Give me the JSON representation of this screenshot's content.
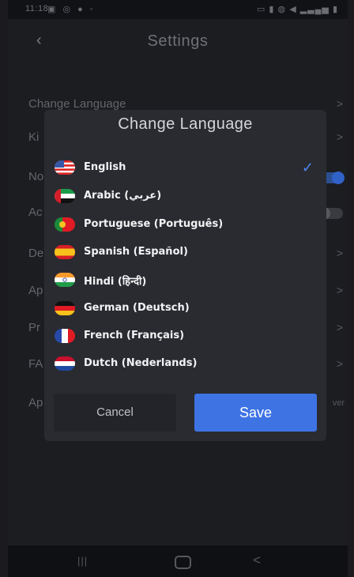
{
  "status_bar": {
    "time": "11:18",
    "left_icons": "▣ ◎ ● ◦",
    "right_icons": "▭ ▮ ◍ ◀ ▂▃▄▅ ▮"
  },
  "header": {
    "title": "Settings"
  },
  "settings": {
    "items": [
      {
        "label": "Change Language",
        "control": "chevron"
      },
      {
        "label": "Ki",
        "control": "chevron"
      },
      {
        "label": "No",
        "control": "toggle-on"
      },
      {
        "label": "Ac",
        "control": "toggle-off"
      },
      {
        "label": "De",
        "control": "chevron"
      },
      {
        "label": "Ap",
        "control": "chevron"
      },
      {
        "label": "Pr",
        "control": "chevron"
      },
      {
        "label": "FA",
        "control": "chevron"
      },
      {
        "label": "Ap",
        "control": "value",
        "value": "ver"
      }
    ]
  },
  "dialog": {
    "title": "Change Language",
    "languages": [
      {
        "label": "English",
        "selected": true,
        "flag": "us-flag"
      },
      {
        "label": "Arabic (عربي)",
        "selected": false,
        "flag": "uae-flag"
      },
      {
        "label": "Portuguese (Português)",
        "selected": false,
        "flag": "portugal-flag"
      },
      {
        "label": "Spanish (Español)",
        "selected": false,
        "flag": "spain-flag"
      },
      {
        "label": "Hindi (हिन्दी)",
        "selected": false,
        "flag": "india-flag"
      },
      {
        "label": "German (Deutsch)",
        "selected": false,
        "flag": "germany-flag"
      },
      {
        "label": "French (Français)",
        "selected": false,
        "flag": "france-flag"
      },
      {
        "label": "Dutch (Nederlands)",
        "selected": false,
        "flag": "netherlands-flag"
      }
    ],
    "cancel_label": "Cancel",
    "save_label": "Save"
  },
  "colors": {
    "accent": "#3e73e4",
    "dialog_bg": "#2a2b30",
    "page_bg": "#1c1d21"
  },
  "nav_bar": {
    "recents_icon": "recents-icon",
    "home_icon": "home-icon",
    "back_icon": "back-icon"
  }
}
